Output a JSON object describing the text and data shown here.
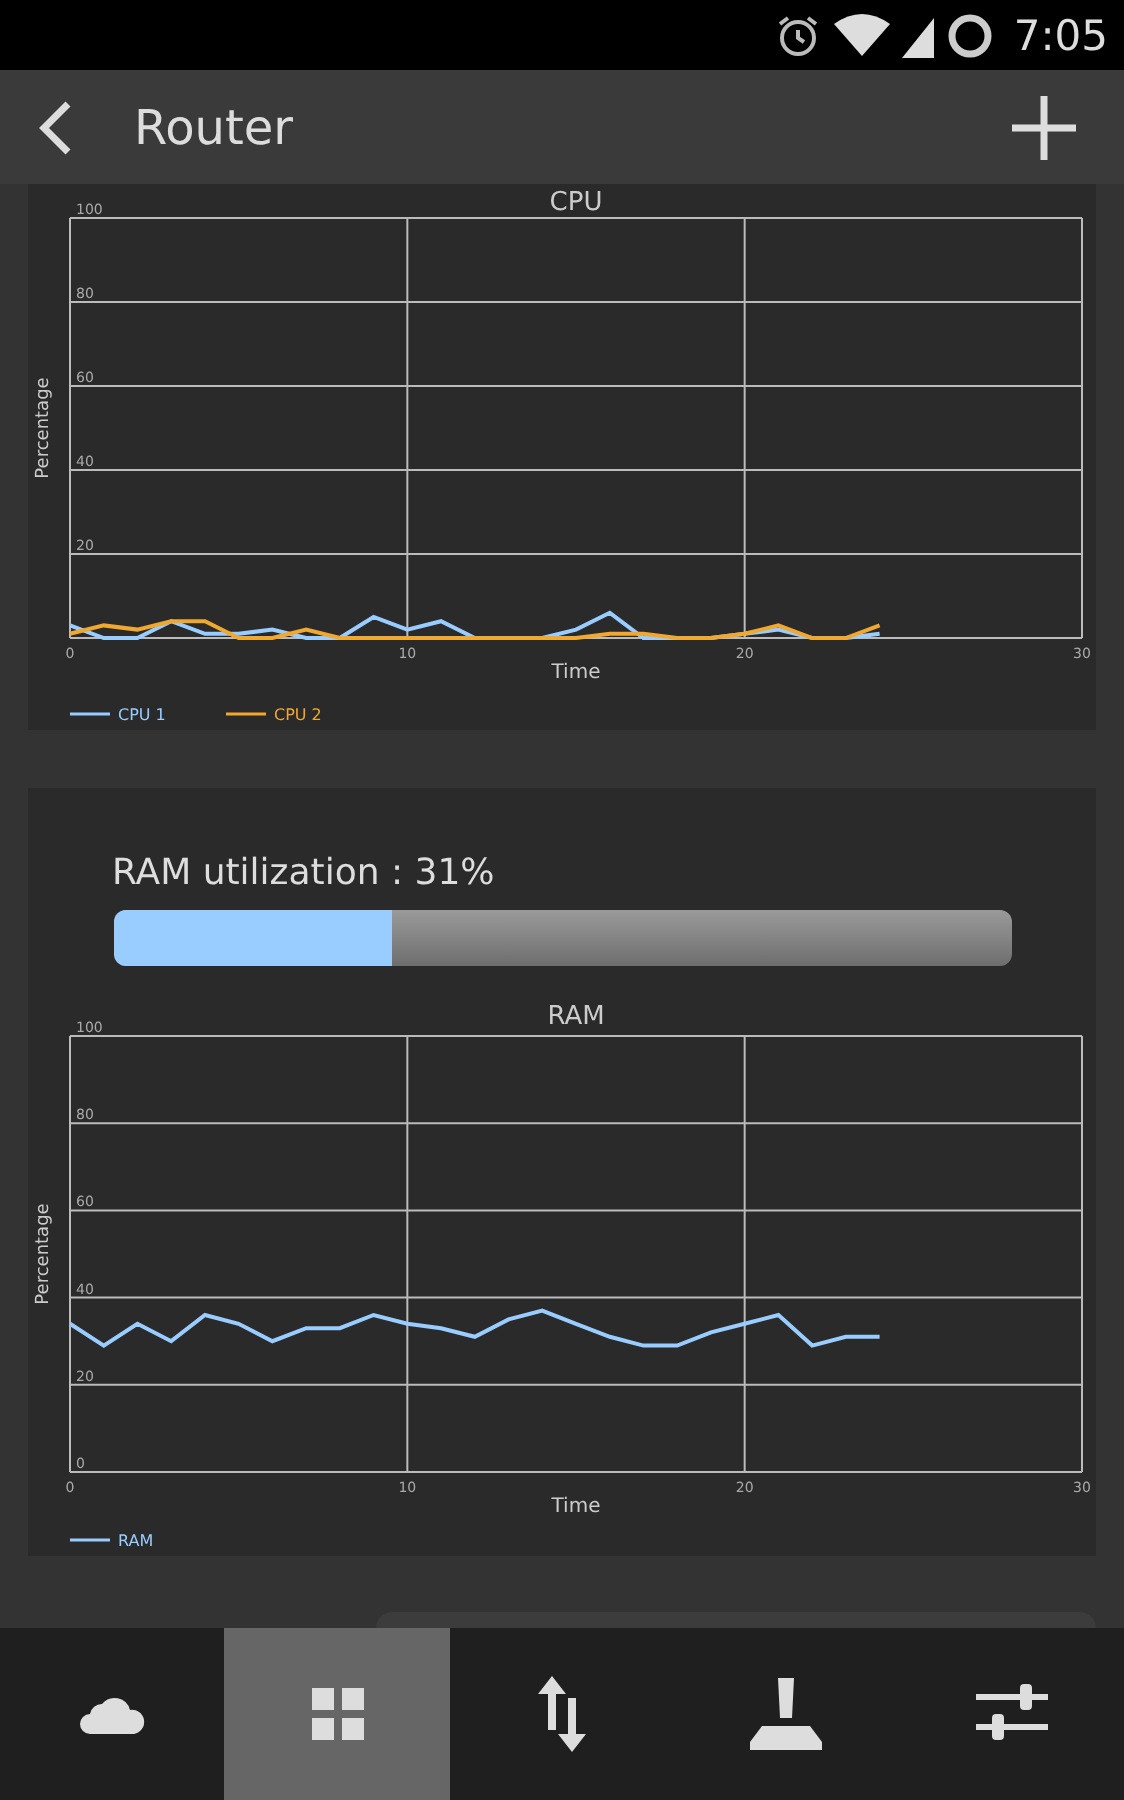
{
  "status_bar": {
    "time": "7:05"
  },
  "app_bar": {
    "title": "Router"
  },
  "cpu_card": {
    "chart_data": {
      "type": "line",
      "title": "CPU",
      "xlabel": "Time",
      "ylabel": "Percentage",
      "x": [
        0,
        1,
        2,
        3,
        4,
        5,
        6,
        7,
        8,
        9,
        10,
        11,
        12,
        13,
        14,
        15,
        16,
        17,
        18,
        19,
        20,
        21,
        22,
        23,
        24
      ],
      "xlim": [
        0,
        30
      ],
      "ylim": [
        0,
        100
      ],
      "xticks": [
        0,
        10,
        20,
        30
      ],
      "yticks": [
        20,
        40,
        60,
        80,
        100
      ],
      "grid": true,
      "legend": "bottom-left",
      "series": [
        {
          "name": "CPU 1",
          "color": "#99ccff",
          "values": [
            3,
            0,
            0,
            4,
            1,
            1,
            2,
            0,
            0,
            5,
            2,
            4,
            0,
            0,
            0,
            2,
            6,
            0,
            0,
            0,
            1,
            2,
            0,
            0,
            1
          ]
        },
        {
          "name": "CPU 2",
          "color": "#f0a830",
          "values": [
            1,
            3,
            2,
            4,
            4,
            0,
            0,
            2,
            0,
            0,
            0,
            0,
            0,
            0,
            0,
            0,
            1,
            1,
            0,
            0,
            1,
            3,
            0,
            0,
            3
          ]
        }
      ]
    }
  },
  "ram_card": {
    "label": "RAM utilization : 31%",
    "level": 0.31,
    "chart_data": {
      "type": "line",
      "title": "RAM",
      "xlabel": "Time",
      "ylabel": "Percentage",
      "x": [
        0,
        1,
        2,
        3,
        4,
        5,
        6,
        7,
        8,
        9,
        10,
        11,
        12,
        13,
        14,
        15,
        16,
        17,
        18,
        19,
        20,
        21,
        22,
        23,
        24
      ],
      "xlim": [
        0,
        30
      ],
      "ylim": [
        0,
        100
      ],
      "xticks": [
        0,
        10,
        20,
        30
      ],
      "yticks": [
        0,
        20,
        40,
        60,
        80,
        100
      ],
      "grid": true,
      "legend": "bottom-left",
      "series": [
        {
          "name": "RAM",
          "color": "#99ccff",
          "values": [
            34,
            29,
            34,
            30,
            36,
            34,
            30,
            33,
            33,
            36,
            34,
            33,
            31,
            35,
            37,
            34,
            31,
            29,
            29,
            32,
            34,
            36,
            29,
            31,
            31
          ]
        }
      ]
    }
  },
  "bottom_nav": [
    {
      "kind": "cloud",
      "selected": false
    },
    {
      "kind": "grid",
      "selected": true
    },
    {
      "kind": "transfer",
      "selected": false
    },
    {
      "kind": "joystick",
      "selected": false
    },
    {
      "kind": "sliders",
      "selected": false
    }
  ]
}
